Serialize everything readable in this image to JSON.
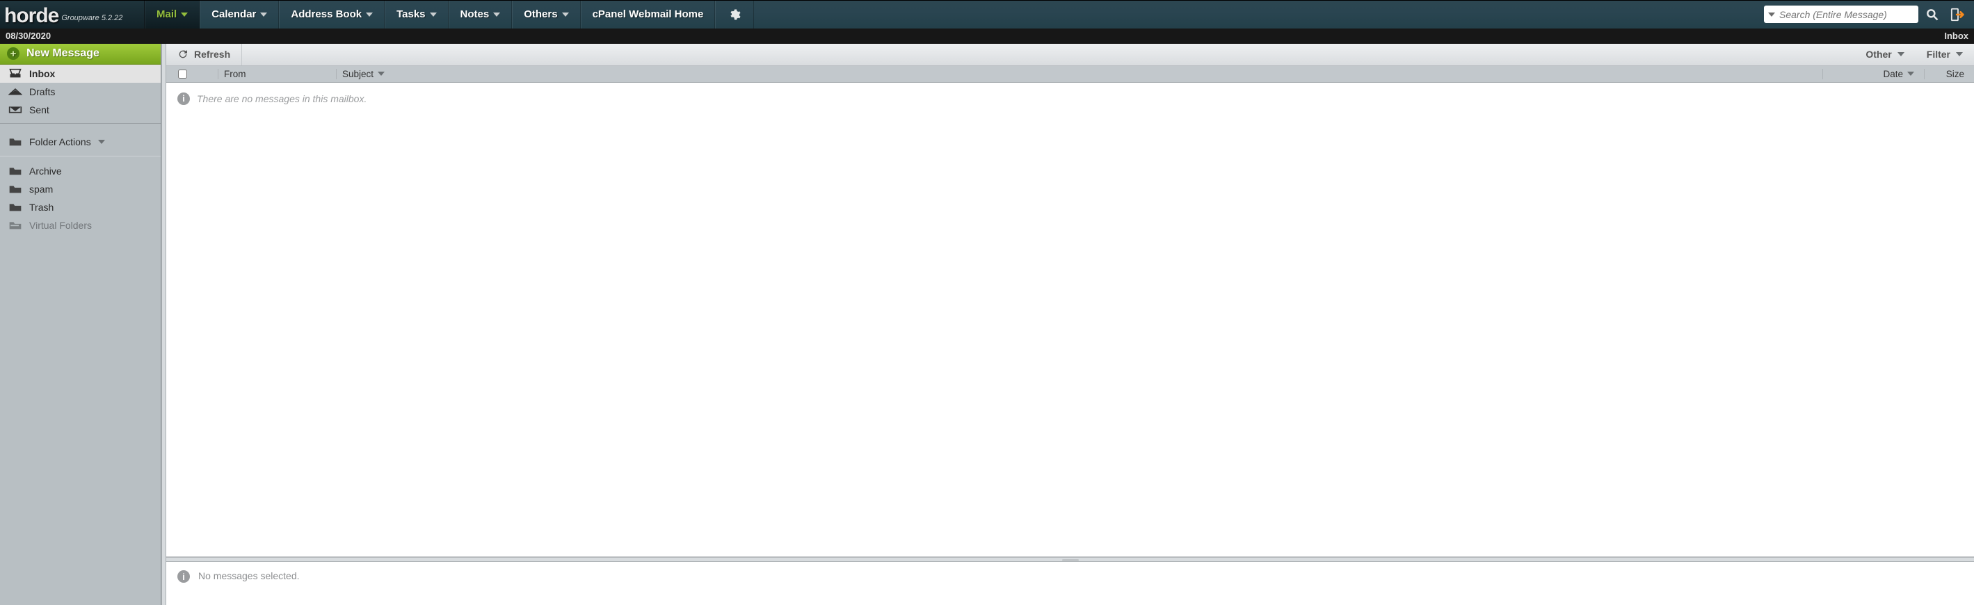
{
  "brand": {
    "name": "horde",
    "sub": "Groupware 5.2.22"
  },
  "nav": {
    "items": [
      {
        "label": "Mail",
        "active": true,
        "dropdown": true
      },
      {
        "label": "Calendar",
        "dropdown": true
      },
      {
        "label": "Address Book",
        "dropdown": true
      },
      {
        "label": "Tasks",
        "dropdown": true
      },
      {
        "label": "Notes",
        "dropdown": true
      },
      {
        "label": "Others",
        "dropdown": true
      },
      {
        "label": "cPanel Webmail Home",
        "dropdown": false
      }
    ]
  },
  "search": {
    "placeholder": "Search (Entire Message)"
  },
  "substrip": {
    "date": "08/30/2020",
    "mailbox": "Inbox"
  },
  "sidebar": {
    "new_message": "New Message",
    "primary": [
      {
        "label": "Inbox",
        "icon": "inbox",
        "selected": true
      },
      {
        "label": "Drafts",
        "icon": "drafts"
      },
      {
        "label": "Sent",
        "icon": "sent"
      }
    ],
    "folder_actions": "Folder Actions",
    "folders": [
      {
        "label": "Archive",
        "icon": "folder"
      },
      {
        "label": "spam",
        "icon": "folder"
      },
      {
        "label": "Trash",
        "icon": "folder"
      },
      {
        "label": "Virtual Folders",
        "icon": "vfolder",
        "muted": true
      }
    ]
  },
  "toolbar": {
    "refresh": "Refresh",
    "other": "Other",
    "filter": "Filter"
  },
  "columns": {
    "from": "From",
    "subject": "Subject",
    "date": "Date",
    "size": "Size"
  },
  "list": {
    "empty": "There are no messages in this mailbox."
  },
  "preview": {
    "empty": "No messages selected."
  }
}
